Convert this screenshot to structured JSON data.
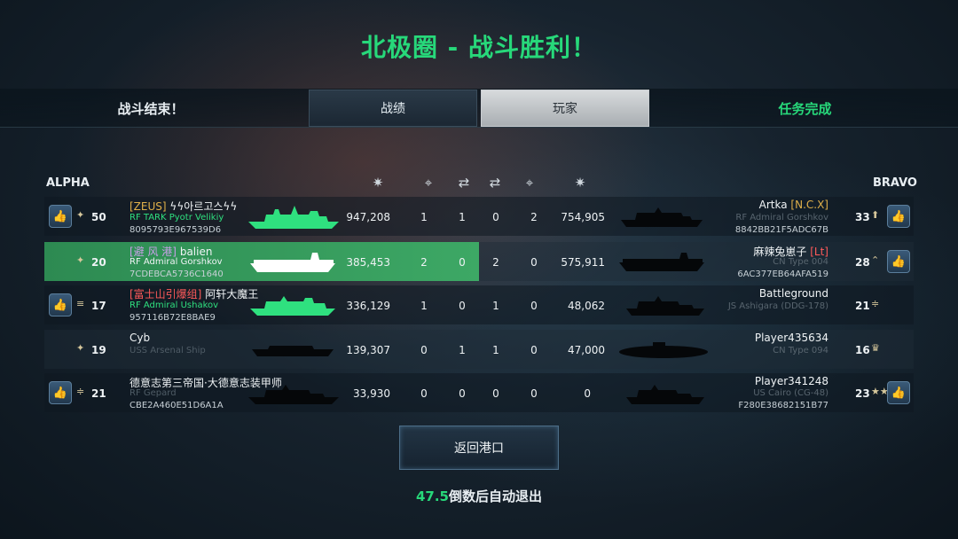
{
  "title": "北极圈 - 战斗胜利！",
  "header": {
    "battle_end": "战斗结束！",
    "tab_stats": "战绩",
    "tab_players": "玩家",
    "mission": "任务完成"
  },
  "teams": {
    "alpha": "ALPHA",
    "bravo": "BRAVO"
  },
  "columns": [
    "damage-icon",
    "crosshair-icon",
    "handshake-icon",
    "handshake-icon",
    "crosshair-icon",
    "damage-icon"
  ],
  "alpha": [
    {
      "level": "50",
      "clan": "[ZEUS]",
      "name": "ϟϟ아르고스ϟϟ",
      "ship": "RF TARK Pyotr Velikiy",
      "id": "8095793E967539D6",
      "damage": "947,208",
      "kills": "1",
      "assists": "1"
    },
    {
      "level": "20",
      "clan": "[避 风 港]",
      "name": "balien",
      "ship": "RF Admiral Gorshkov",
      "id": "7CDEBCA5736C1640",
      "damage": "385,453",
      "kills": "2",
      "assists": "0"
    },
    {
      "level": "17",
      "clan": "[富士山引爆组]",
      "name": "阿轩大魔王",
      "ship": "RF Admiral Ushakov",
      "id": "957116B72E8BAE9",
      "damage": "336,129",
      "kills": "1",
      "assists": "0"
    },
    {
      "level": "19",
      "clan": "",
      "name": "Cyb",
      "ship": "USS Arsenal Ship",
      "id": "",
      "damage": "139,307",
      "kills": "0",
      "assists": "1"
    },
    {
      "level": "21",
      "clan": "",
      "name": "德意志第三帝国·大德意志装甲师",
      "ship": "RF Gepard",
      "id": "CBE2A460E51D6A1A",
      "damage": "33,930",
      "kills": "0",
      "assists": "0"
    }
  ],
  "bravo": [
    {
      "level": "33",
      "clan": "[N.C.X]",
      "name": "Artka",
      "ship": "RF Admiral Gorshkov",
      "id": "8842BB21F5ADC67B",
      "damage": "754,905",
      "kills": "2",
      "assists": "0"
    },
    {
      "level": "28",
      "clan": "[Lt]",
      "name": "麻辣兔崽子",
      "ship": "CN Type 004",
      "id": "6AC377EB64AFA519",
      "damage": "575,911",
      "kills": "0",
      "assists": "2"
    },
    {
      "level": "21",
      "clan": "",
      "name": "Battleground",
      "ship": "JS Ashigara (DDG-178)",
      "id": "",
      "damage": "48,062",
      "kills": "0",
      "assists": "1"
    },
    {
      "level": "16",
      "clan": "",
      "name": "Player435634",
      "ship": "CN Type 094",
      "id": "",
      "damage": "47,000",
      "kills": "0",
      "assists": "1"
    },
    {
      "level": "23",
      "clan": "",
      "name": "Player341248",
      "ship": "US Cairo (CG-48)",
      "id": "F280E38682151B77",
      "damage": "0",
      "kills": "0",
      "assists": "0"
    }
  ],
  "return_button": "返回港口",
  "countdown": {
    "number": "47.5",
    "text": "倒数后自动退出"
  }
}
